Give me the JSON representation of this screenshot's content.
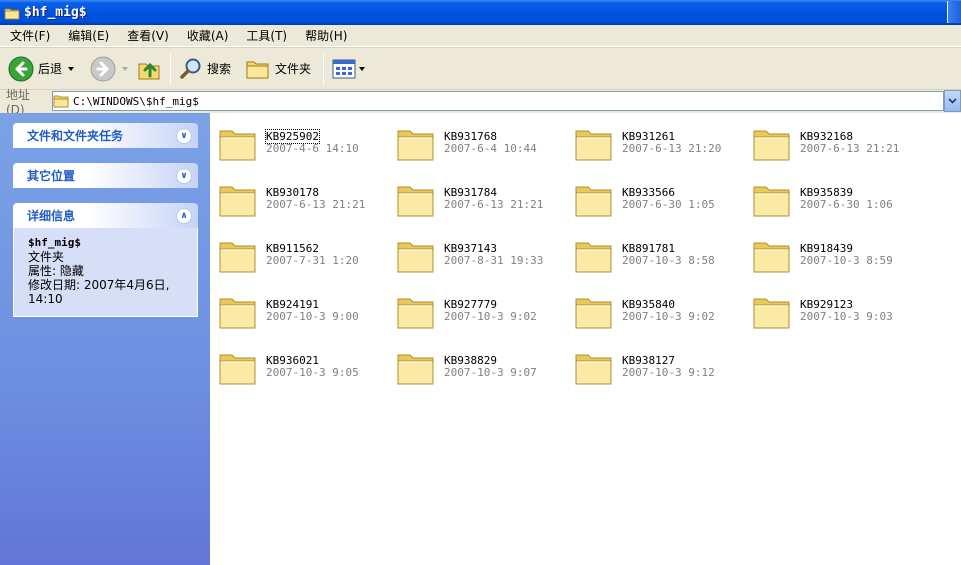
{
  "window": {
    "title": "$hf_mig$"
  },
  "menu": [
    "文件(F)",
    "编辑(E)",
    "查看(V)",
    "收藏(A)",
    "工具(T)",
    "帮助(H)"
  ],
  "toolbar": {
    "back_label": "后退",
    "search_label": "搜索",
    "folders_label": "文件夹"
  },
  "address": {
    "label": "地址(D)",
    "value": "C:\\WINDOWS\\$hf_mig$"
  },
  "tasks": {
    "file_tasks_title": "文件和文件夹任务",
    "other_places_title": "其它位置",
    "details_title": "详细信息",
    "details": {
      "name": "$hf_mig$",
      "type": "文件夹",
      "attributes": "属性: 隐藏",
      "modified": "修改日期: 2007年4月6日, 14:10"
    }
  },
  "colors": {
    "title_bar": "#0053e0",
    "task_pane": "#7ba2e7",
    "task_header_text": "#215dc6"
  },
  "items": [
    {
      "name": "KB925902",
      "date": "2007-4-6 14:10"
    },
    {
      "name": "KB931768",
      "date": "2007-6-4 10:44"
    },
    {
      "name": "KB931261",
      "date": "2007-6-13 21:20"
    },
    {
      "name": "KB932168",
      "date": "2007-6-13 21:21"
    },
    {
      "name": "KB930178",
      "date": "2007-6-13 21:21"
    },
    {
      "name": "KB931784",
      "date": "2007-6-13 21:21"
    },
    {
      "name": "KB933566",
      "date": "2007-6-30 1:05"
    },
    {
      "name": "KB935839",
      "date": "2007-6-30 1:06"
    },
    {
      "name": "KB911562",
      "date": "2007-7-31 1:20"
    },
    {
      "name": "KB937143",
      "date": "2007-8-31 19:33"
    },
    {
      "name": "KB891781",
      "date": "2007-10-3 8:58"
    },
    {
      "name": "KB918439",
      "date": "2007-10-3 8:59"
    },
    {
      "name": "KB924191",
      "date": "2007-10-3 9:00"
    },
    {
      "name": "KB927779",
      "date": "2007-10-3 9:02"
    },
    {
      "name": "KB935840",
      "date": "2007-10-3 9:02"
    },
    {
      "name": "KB929123",
      "date": "2007-10-3 9:03"
    },
    {
      "name": "KB936021",
      "date": "2007-10-3 9:05"
    },
    {
      "name": "KB938829",
      "date": "2007-10-3 9:07"
    },
    {
      "name": "KB938127",
      "date": "2007-10-3 9:12"
    }
  ]
}
